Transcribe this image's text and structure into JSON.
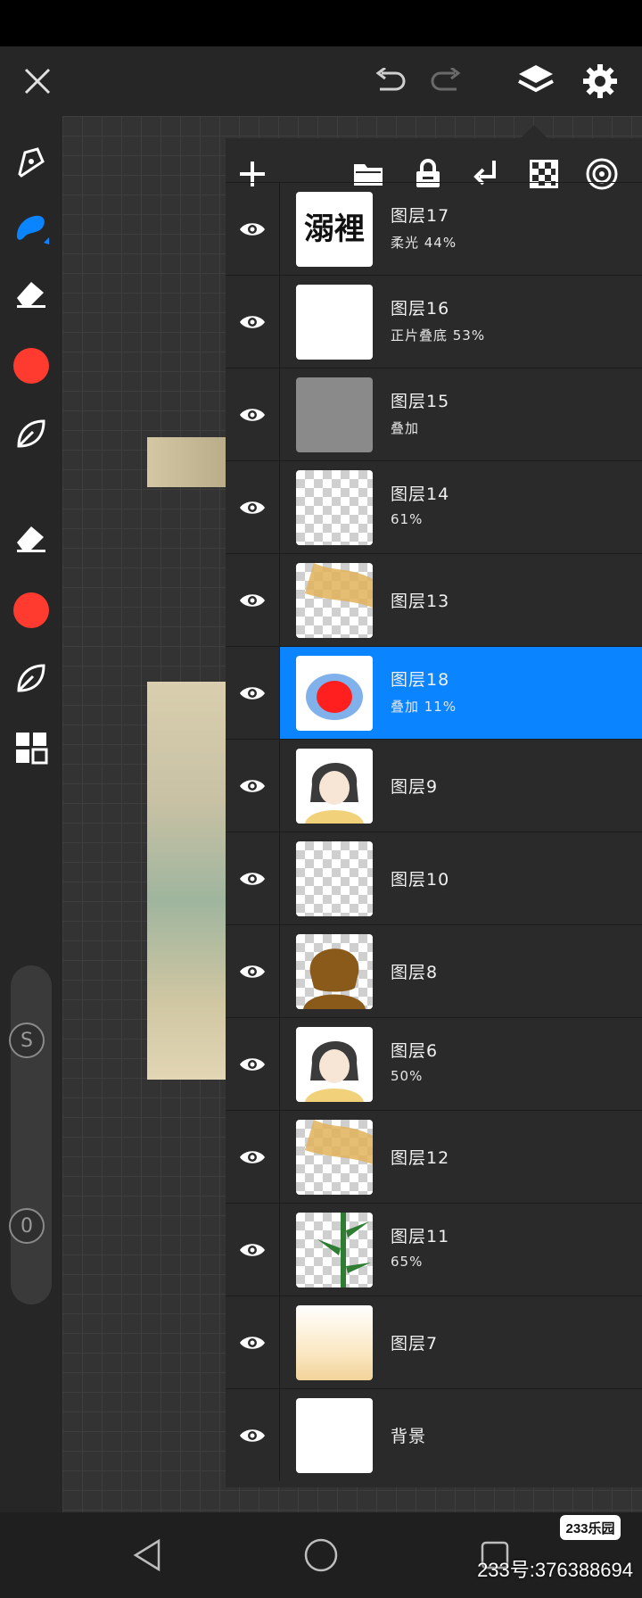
{
  "topbar": {
    "close_icon": "close-icon",
    "undo_icon": "undo-icon",
    "redo_icon": "redo-icon",
    "layers_icon": "layers-icon",
    "settings_icon": "gear-icon"
  },
  "colors": {
    "accent": "#0a84ff",
    "brush_color": "#ff3b30"
  },
  "toolbar": {
    "size_slider_label": "S",
    "opacity_slider_label": "0"
  },
  "layers_panel": {
    "actions": [
      "add-layer-icon",
      "folder-icon",
      "lock-icon",
      "merge-down-icon",
      "transparency-icon",
      "blend-mode-icon"
    ],
    "layers": [
      {
        "name": "图层17",
        "sub": "柔光  44%"
      },
      {
        "name": "图层16",
        "sub": "正片叠底  53%"
      },
      {
        "name": "图层15",
        "sub": "叠加"
      },
      {
        "name": "图层14",
        "sub": "61%"
      },
      {
        "name": "图层13",
        "sub": ""
      },
      {
        "name": "图层18",
        "sub": "叠加  11%",
        "selected": true
      },
      {
        "name": "图层9",
        "sub": ""
      },
      {
        "name": "图层10",
        "sub": ""
      },
      {
        "name": "图层8",
        "sub": ""
      },
      {
        "name": "图层6",
        "sub": "50%"
      },
      {
        "name": "图层12",
        "sub": ""
      },
      {
        "name": "图层11",
        "sub": "65%"
      },
      {
        "name": "图层7",
        "sub": ""
      },
      {
        "name": "背景",
        "sub": ""
      }
    ],
    "thumb17_text": "溺裡"
  },
  "watermark": {
    "badge": "233乐园",
    "text": "233号:376388694"
  }
}
